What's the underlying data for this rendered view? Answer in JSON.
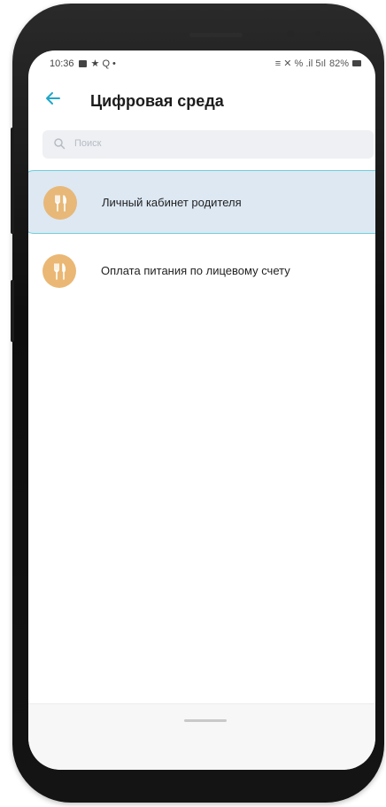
{
  "status_bar": {
    "time": "10:36",
    "indicators_left": "★ Q •",
    "indicators_right": "≡ ✕ % .il 5ıl",
    "battery": "82%"
  },
  "header": {
    "title": "Цифровая среда",
    "back_icon": "arrow-left-icon"
  },
  "search": {
    "placeholder": "Поиск",
    "icon": "search-icon"
  },
  "list": {
    "items": [
      {
        "label": "Личный кабинет родителя",
        "icon": "fork-knife-icon",
        "selected": true
      },
      {
        "label": "Оплата питания по лицевому счету",
        "icon": "fork-knife-icon",
        "selected": false
      }
    ]
  },
  "colors": {
    "accent": "#20a6c8",
    "item_icon_bg": "#e7b878",
    "selected_bg": "#dde8f3",
    "selected_border": "#6fd0dc"
  }
}
